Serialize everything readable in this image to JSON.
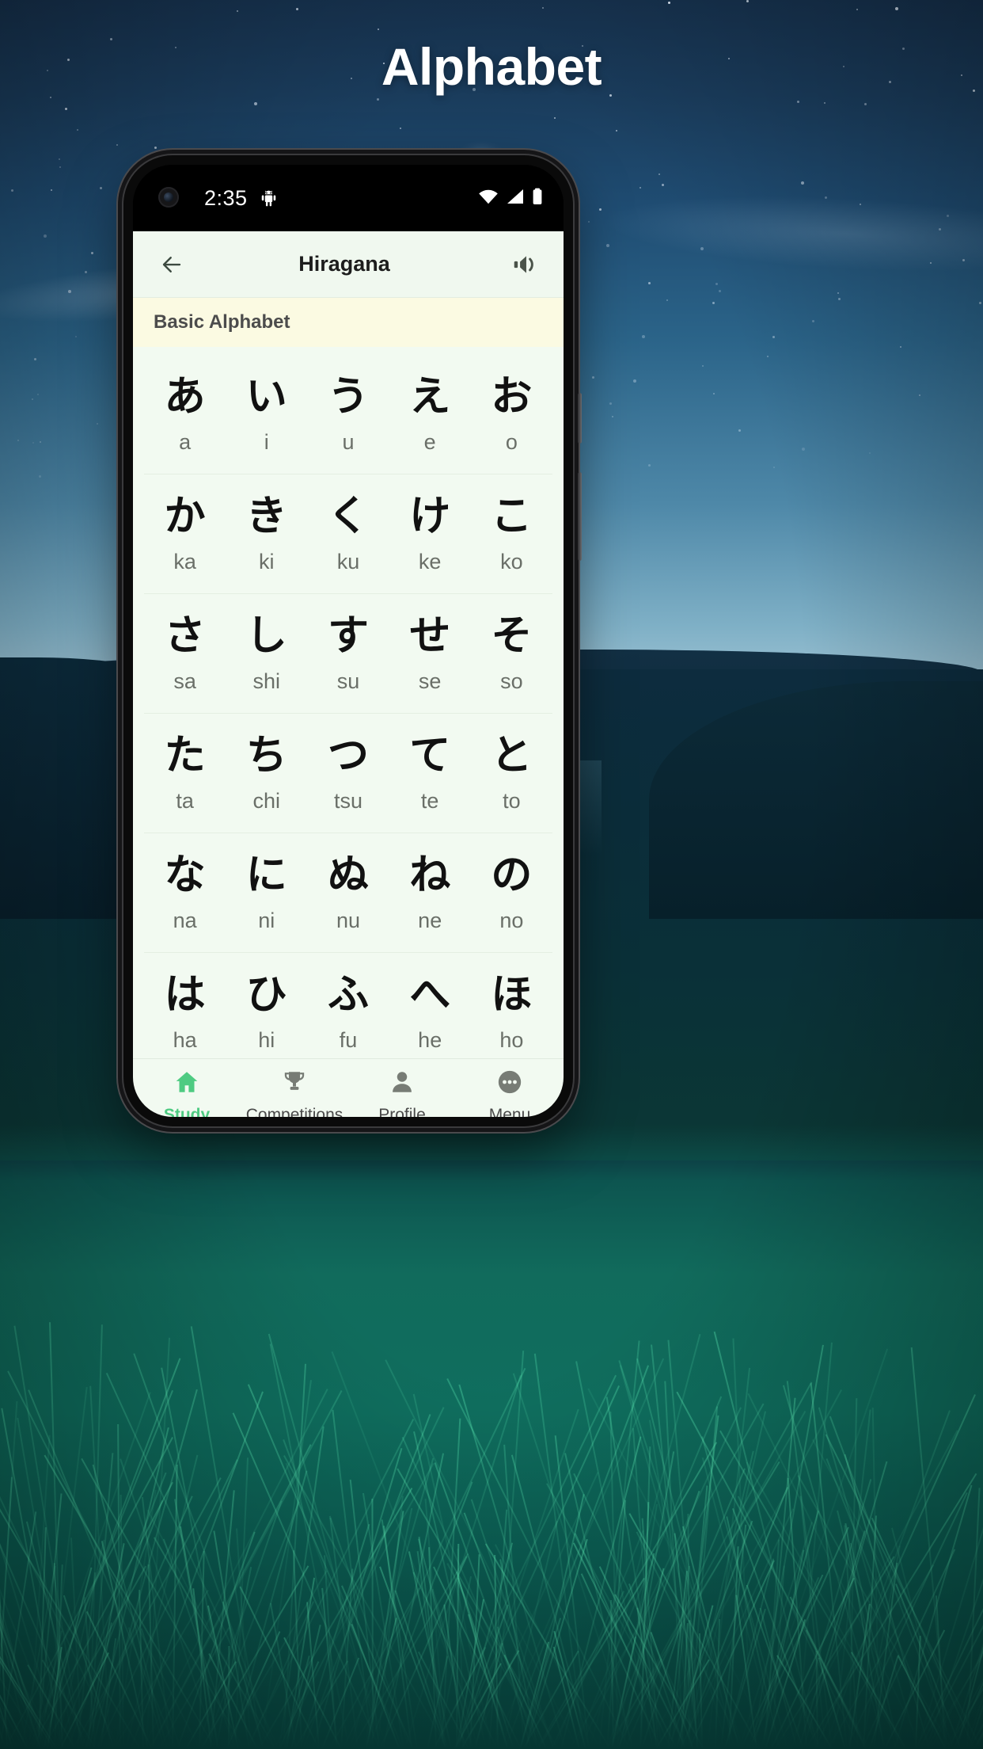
{
  "page": {
    "title": "Alphabet",
    "background": {
      "scene": "night-landscape",
      "sky_top_color": "#16314d",
      "sky_horizon_color": "#9cc2d3",
      "grass_color": "#116b5c"
    }
  },
  "phone": {
    "statusbar": {
      "time": "2:35",
      "notification_icon": "android-gear-icon",
      "icons": [
        "wifi-icon",
        "signal-icon",
        "battery-icon"
      ]
    },
    "appbar": {
      "back_icon": "back-arrow-icon",
      "title": "Hiragana",
      "action_icon": "speaker-icon"
    },
    "section": {
      "label": "Basic Alphabet",
      "background_color": "#fbfae2"
    },
    "kana_table": {
      "rows": [
        [
          {
            "kana": "あ",
            "romaji": "a"
          },
          {
            "kana": "い",
            "romaji": "i"
          },
          {
            "kana": "う",
            "romaji": "u"
          },
          {
            "kana": "え",
            "romaji": "e"
          },
          {
            "kana": "お",
            "romaji": "o"
          }
        ],
        [
          {
            "kana": "か",
            "romaji": "ka"
          },
          {
            "kana": "き",
            "romaji": "ki"
          },
          {
            "kana": "く",
            "romaji": "ku"
          },
          {
            "kana": "け",
            "romaji": "ke"
          },
          {
            "kana": "こ",
            "romaji": "ko"
          }
        ],
        [
          {
            "kana": "さ",
            "romaji": "sa"
          },
          {
            "kana": "し",
            "romaji": "shi"
          },
          {
            "kana": "す",
            "romaji": "su"
          },
          {
            "kana": "せ",
            "romaji": "se"
          },
          {
            "kana": "そ",
            "romaji": "so"
          }
        ],
        [
          {
            "kana": "た",
            "romaji": "ta"
          },
          {
            "kana": "ち",
            "romaji": "chi"
          },
          {
            "kana": "つ",
            "romaji": "tsu"
          },
          {
            "kana": "て",
            "romaji": "te"
          },
          {
            "kana": "と",
            "romaji": "to"
          }
        ],
        [
          {
            "kana": "な",
            "romaji": "na"
          },
          {
            "kana": "に",
            "romaji": "ni"
          },
          {
            "kana": "ぬ",
            "romaji": "nu"
          },
          {
            "kana": "ね",
            "romaji": "ne"
          },
          {
            "kana": "の",
            "romaji": "no"
          }
        ],
        [
          {
            "kana": "は",
            "romaji": "ha"
          },
          {
            "kana": "ひ",
            "romaji": "hi"
          },
          {
            "kana": "ふ",
            "romaji": "fu"
          },
          {
            "kana": "へ",
            "romaji": "he"
          },
          {
            "kana": "ほ",
            "romaji": "ho"
          }
        ]
      ]
    },
    "bottom_nav": {
      "active_color": "#4ecb82",
      "items": [
        {
          "label": "Study",
          "icon": "home-icon",
          "active": true
        },
        {
          "label": "Competitions",
          "icon": "trophy-icon",
          "active": false
        },
        {
          "label": "Profile",
          "icon": "person-icon",
          "active": false
        },
        {
          "label": "Menu",
          "icon": "more-icon",
          "active": false
        }
      ]
    }
  }
}
